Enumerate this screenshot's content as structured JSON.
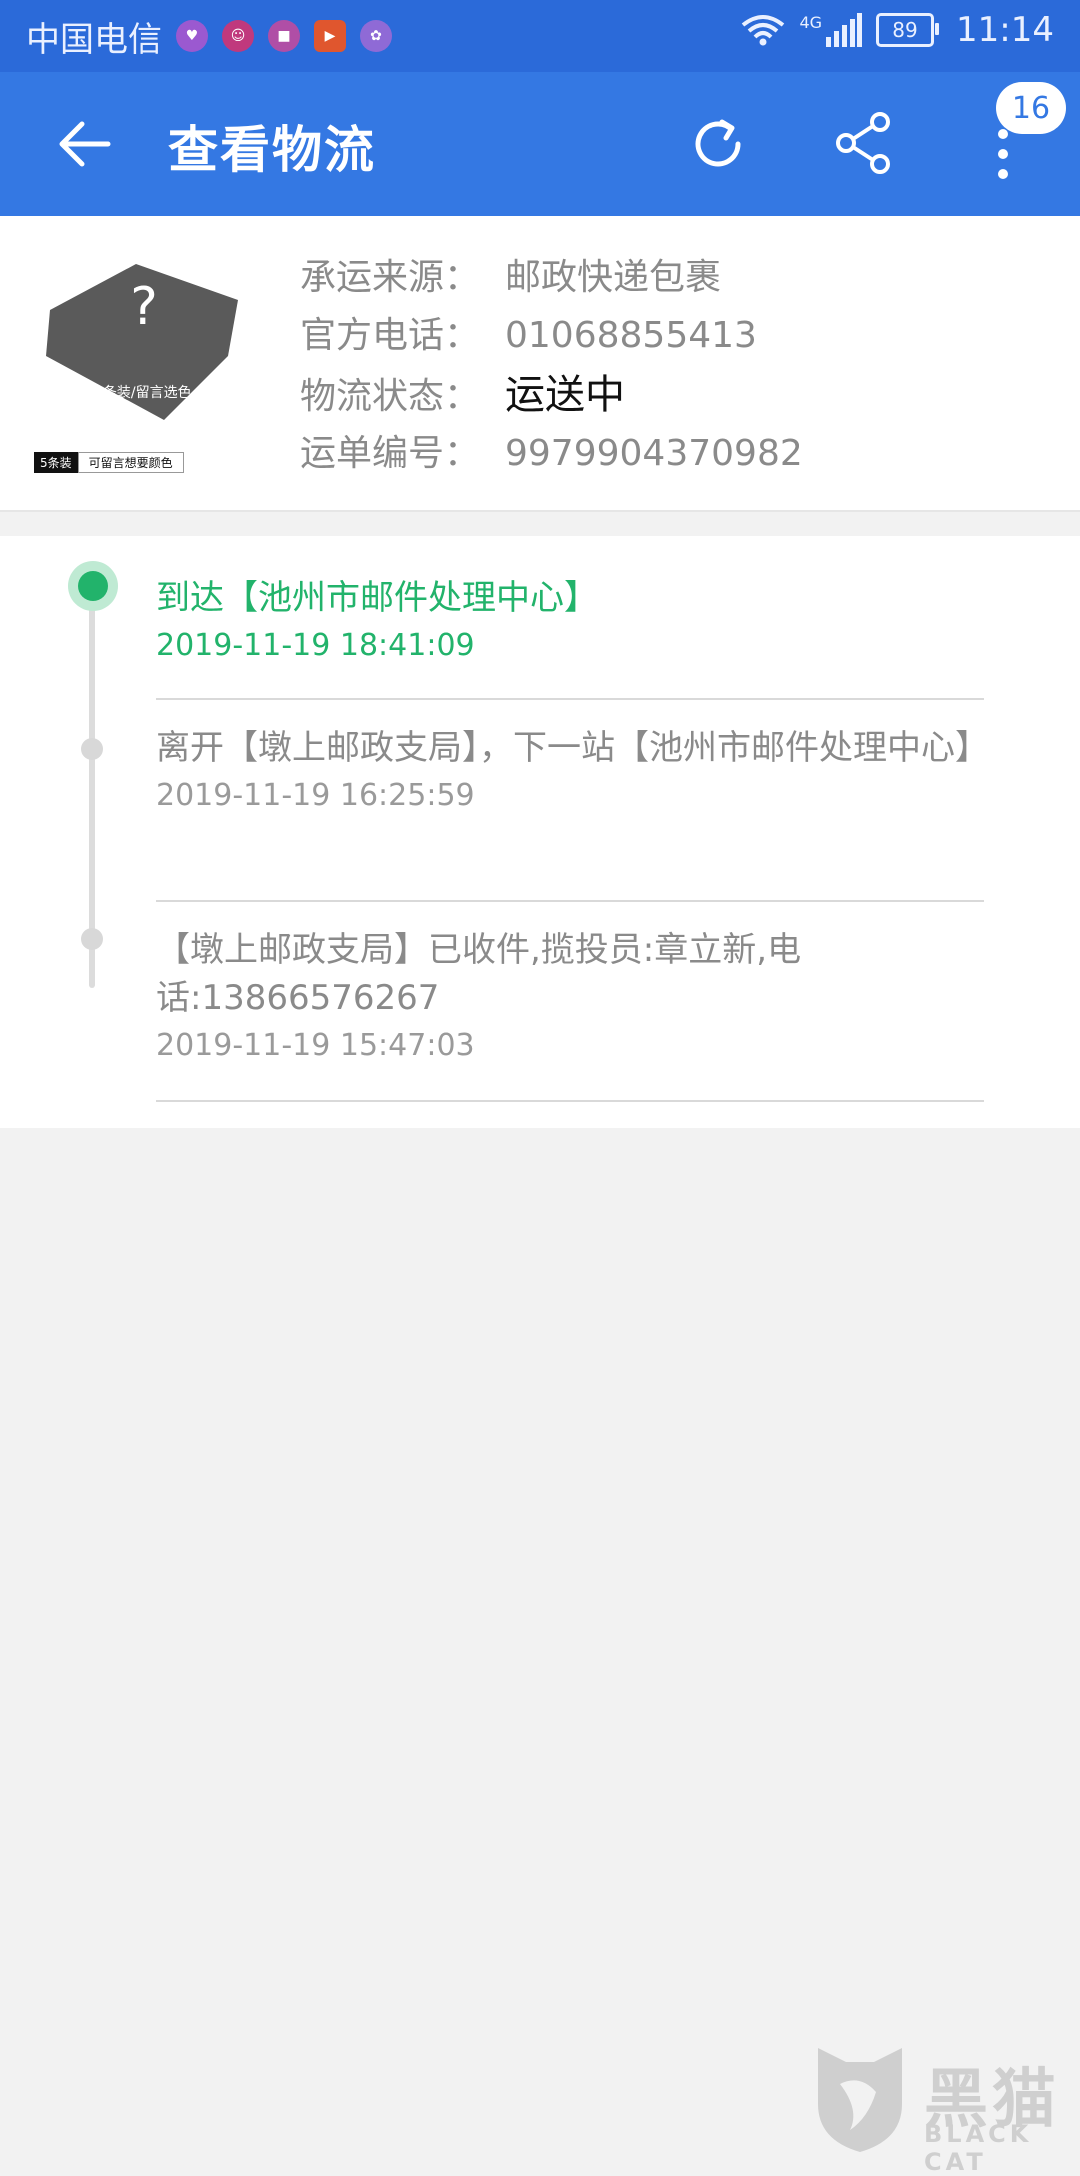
{
  "status_bar": {
    "carrier": "中国电信",
    "network": "4G",
    "battery": "89",
    "time": "11:14",
    "app_icons": [
      {
        "name": "app-icon-1",
        "color": "#9b59d0"
      },
      {
        "name": "app-icon-2",
        "color": "#c0397d"
      },
      {
        "name": "app-icon-3",
        "color": "#b04ea6"
      },
      {
        "name": "video-app-icon",
        "color": "#e0562e"
      },
      {
        "name": "app-icon-5",
        "color": "#8f6ad6"
      }
    ]
  },
  "app_bar": {
    "title": "查看物流",
    "notification_count": "16",
    "color": "#3478e3"
  },
  "shipment": {
    "thumb_caption": "5条装/留言选色",
    "thumb_tag_left": "5条装",
    "thumb_tag_right": "可留言想要颜色",
    "rows": [
      {
        "label": "承运来源：",
        "value": "邮政快递包裹"
      },
      {
        "label": "官方电话：",
        "value": "01068855413"
      },
      {
        "label": "物流状态：",
        "value": "运送中"
      },
      {
        "label": "运单编号：",
        "value": "9979904370982"
      }
    ]
  },
  "tracking": {
    "accent_color": "#22b36b",
    "events": [
      {
        "desc": "到达【池州市邮件处理中心】",
        "time": "2019-11-19 18:41:09"
      },
      {
        "desc": "离开【墩上邮政支局】，下一站【池州市邮件处理中心】",
        "time": "2019-11-19 16:25:59"
      },
      {
        "desc": "【墩上邮政支局】已收件,揽投员:章立新,电话:13866576267",
        "time": "2019-11-19 15:47:03"
      }
    ]
  },
  "watermark": {
    "cn": "黑猫",
    "en": "BLACK CAT"
  }
}
